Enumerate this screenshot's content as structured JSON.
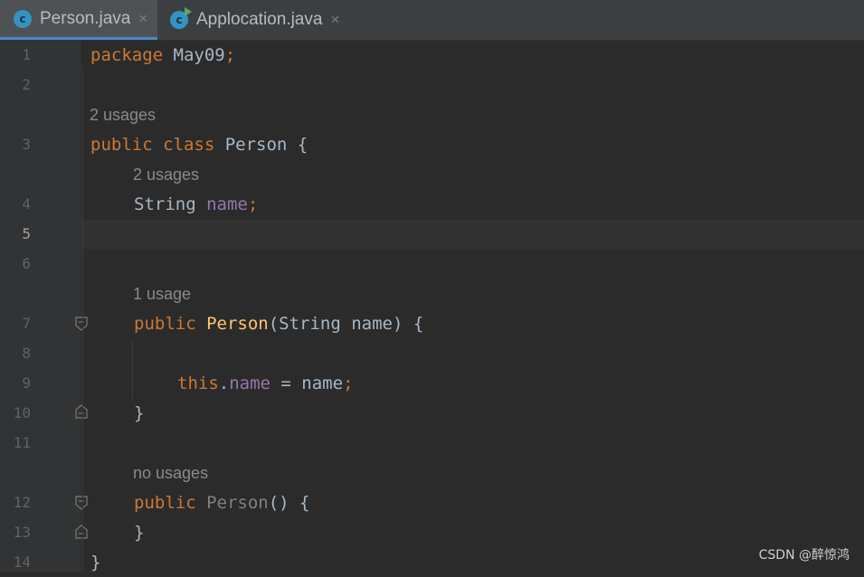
{
  "tabs": [
    {
      "icon": "java-class-icon",
      "label": "Person.java",
      "active": true
    },
    {
      "icon": "java-runnable-class-icon",
      "label": "Applocation.java",
      "active": false
    }
  ],
  "tab_close_glyph": "×",
  "icon_letter": "c",
  "line_numbers": [
    "1",
    "2",
    "3",
    "4",
    "5",
    "6",
    "7",
    "8",
    "9",
    "10",
    "11",
    "12",
    "13",
    "14"
  ],
  "current_line": "5",
  "hints": {
    "class_person": "2 usages",
    "field_name": "2 usages",
    "ctor_with_arg": "1 usage",
    "ctor_no_arg": "no usages"
  },
  "code": {
    "l1_kw": "package",
    "l1_pkg": " May09",
    "l1_semi": ";",
    "l3_kw1": "public",
    "l3_kw2": " class",
    "l3_name": " Person {",
    "l4_type": "String ",
    "l4_field": "name",
    "l4_semi": ";",
    "l7_kw": "public ",
    "l7_fn": "Person",
    "l7_rest": "(String name) {",
    "l9_this": "this",
    "l9_dot": ".",
    "l9_field": "name",
    "l9_rest": " = name",
    "l9_semi": ";",
    "l10": "}",
    "l12_kw": "public ",
    "l12_fn": "Person",
    "l12_rest": "() {",
    "l13": "}",
    "l14": "}"
  },
  "watermark": "CSDN @醉惊鸿",
  "colors": {
    "background": "#2b2b2b",
    "gutter": "#313335",
    "keyword": "#cc7832",
    "field": "#9876aa",
    "method": "#ffc66d",
    "text": "#a9b7c6",
    "hint": "#8a8a8a",
    "tab_accent": "#4a88c7"
  }
}
